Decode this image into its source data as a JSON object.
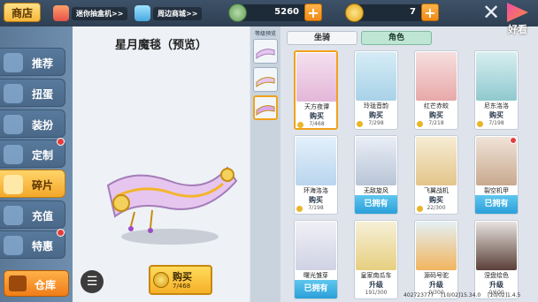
{
  "header": {
    "title": "商店",
    "promos": [
      {
        "label": "迷你抽盒机>>",
        "icon": "gift-box-icon"
      },
      {
        "label": "周边商城>>",
        "icon": "diamond-icon"
      }
    ],
    "currencies": [
      {
        "name": "mini-bean",
        "value": "5260",
        "icon": "bean-coin-icon",
        "color": "#7fb07a"
      },
      {
        "name": "mini-coin",
        "value": "7",
        "icon": "gold-coin-icon",
        "color": "#f2c230"
      }
    ]
  },
  "watermark": {
    "text": "好看"
  },
  "sidebar": {
    "items": [
      {
        "label": "推荐",
        "icon": "star-icon",
        "active": false,
        "badge": false
      },
      {
        "label": "扭蛋",
        "icon": "capsule-icon",
        "active": false,
        "badge": false
      },
      {
        "label": "装扮",
        "icon": "hanger-icon",
        "active": false,
        "badge": false
      },
      {
        "label": "定制",
        "icon": "brush-icon",
        "active": false,
        "badge": true
      },
      {
        "label": "碎片",
        "icon": "fragment-icon",
        "active": true,
        "badge": false
      },
      {
        "label": "充值",
        "icon": "coin-stack-icon",
        "active": false,
        "badge": false
      },
      {
        "label": "特惠",
        "icon": "sale-icon",
        "active": false,
        "badge": true
      }
    ],
    "warehouse": "仓库"
  },
  "preview": {
    "title": "星月魔毯（预览）",
    "buy_label": "购买",
    "buy_price": "7/468"
  },
  "levels": {
    "label": "等级预览"
  },
  "tabs": [
    {
      "label": "坐骑",
      "active": false
    },
    {
      "label": "角色",
      "active": true
    }
  ],
  "items": [
    {
      "name": "天方夜谭",
      "action": "购买",
      "price": "7/468",
      "status": "buy",
      "selected": true,
      "badge": false,
      "color": "#f5e0ef"
    },
    {
      "name": "玲珑音韵",
      "action": "购买",
      "price": "7/298",
      "status": "buy",
      "selected": false,
      "badge": false,
      "color": "#d6ecf6"
    },
    {
      "name": "红芒赤蛟",
      "action": "购买",
      "price": "7/218",
      "status": "buy",
      "selected": false,
      "badge": false,
      "color": "#f6dede"
    },
    {
      "name": "尼东洛洛",
      "action": "购买",
      "price": "7/198",
      "status": "buy",
      "selected": false,
      "badge": false,
      "color": "#d7eef0"
    },
    {
      "name": "环海洛洛",
      "action": "购买",
      "price": "7/198",
      "status": "buy",
      "selected": false,
      "badge": false,
      "color": "#e4f0fb"
    },
    {
      "name": "无敌旋风",
      "action": "已拥有",
      "price": "",
      "status": "owned",
      "selected": false,
      "badge": false,
      "color": "#e9eef6"
    },
    {
      "name": "飞翼战机",
      "action": "购买",
      "price": "22/300",
      "status": "buy",
      "selected": false,
      "badge": false,
      "color": "#f6ecd4"
    },
    {
      "name": "裂空机甲",
      "action": "已拥有",
      "price": "",
      "status": "owned",
      "selected": false,
      "badge": true,
      "color": "#efe3d8"
    },
    {
      "name": "曙光雏芽",
      "action": "已拥有",
      "price": "",
      "status": "owned",
      "selected": false,
      "badge": false,
      "color": "#f0f0f6"
    },
    {
      "name": "皇家南瓜车",
      "action": "升级",
      "price": "191/300",
      "status": "upgrade",
      "selected": false,
      "badge": false,
      "color": "#f6f0d8"
    },
    {
      "name": "源码号驼",
      "action": "升级",
      "price": "0/300",
      "status": "upgrade",
      "selected": false,
      "badge": false,
      "color": "#e4f0f4"
    },
    {
      "name": "涅盘绘色",
      "action": "升级",
      "price": "0/600",
      "status": "upgrade",
      "selected": false,
      "badge": false,
      "color": "#e8e2de"
    }
  ],
  "status_bar": [
    "402723777",
    "[10/02]15.34.0",
    "[10/02]1.4.5"
  ]
}
